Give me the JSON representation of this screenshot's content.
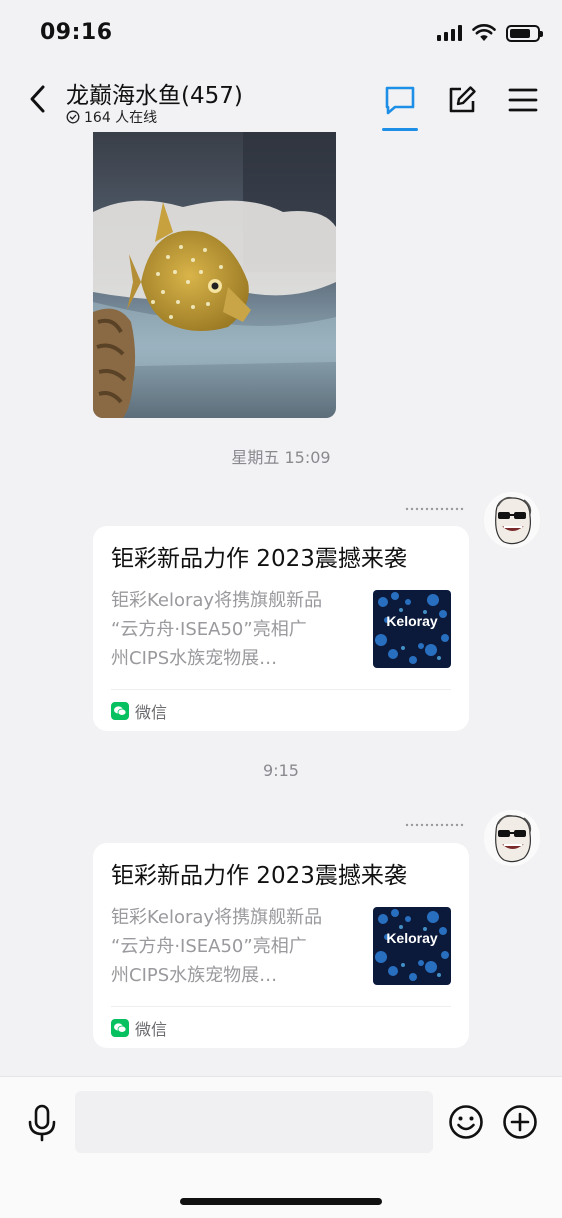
{
  "status_bar": {
    "time": "09:16"
  },
  "header": {
    "title": "龙巅海水鱼(457)",
    "online": "164 人在线"
  },
  "messages": [
    {
      "type": "image",
      "description": "fish-photo"
    },
    {
      "type": "timestamp",
      "text": "星期五 15:09"
    },
    {
      "type": "link_card",
      "title": "钜彩新品力作 2023震撼来袭",
      "description": "钜彩Keloray将携旗舰新品\n“云方舟·ISEA50”亮相广\n州CIPS水族宠物展…",
      "source": "微信",
      "thumb_text": "Keloray"
    },
    {
      "type": "timestamp",
      "text": "9:15"
    },
    {
      "type": "link_card",
      "title": "钜彩新品力作 2023震撼来袭",
      "description": "钜彩Keloray将携旗舰新品\n“云方舟·ISEA50”亮相广\n州CIPS水族宠物展…",
      "source": "微信",
      "thumb_text": "Keloray"
    }
  ],
  "input": {
    "placeholder": ""
  },
  "colors": {
    "accent": "#1e8fe6",
    "wechat_green": "#07c160",
    "background": "#f2f2f5"
  }
}
